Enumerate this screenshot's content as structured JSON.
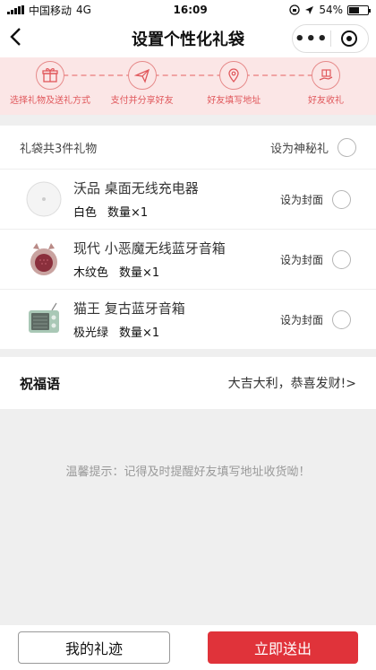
{
  "status_bar": {
    "carrier": "中国移动",
    "network": "4G",
    "time": "16:09",
    "battery": "54%",
    "battery_level": 0.54
  },
  "nav": {
    "title": "设置个性化礼袋",
    "back_icon": "chevron-left-icon",
    "more": "•••"
  },
  "steps": [
    {
      "label": "选择礼物及送礼方式",
      "icon": "gift-icon"
    },
    {
      "label": "支付并分享好友",
      "icon": "send-icon"
    },
    {
      "label": "好友填写地址",
      "icon": "location-icon"
    },
    {
      "label": "好友收礼",
      "icon": "gift-hand-icon"
    }
  ],
  "gift_list": {
    "summary": "礼袋共3件礼物",
    "mystery_label": "设为神秘礼",
    "items": [
      {
        "name": "沃品 桌面无线充电器",
        "color": "白色",
        "qty": "数量×1",
        "cover_label": "设为封面"
      },
      {
        "name": "现代 小恶魔无线蓝牙音箱",
        "color": "木纹色",
        "qty": "数量×1",
        "cover_label": "设为封面"
      },
      {
        "name": "猫王 复古蓝牙音箱",
        "color": "极光绿",
        "qty": "数量×1",
        "cover_label": "设为封面"
      }
    ]
  },
  "blessing": {
    "label": "祝福语",
    "value": "大吉大利，恭喜发财!>"
  },
  "tip": "温馨提示：记得及时提醒好友填写地址收货呦！",
  "footer": {
    "my_gifts": "我的礼迹",
    "send_now": "立即送出"
  },
  "colors": {
    "accent": "#e0333a",
    "step_bg": "#fbe6e6",
    "step_text": "#e0575b"
  }
}
